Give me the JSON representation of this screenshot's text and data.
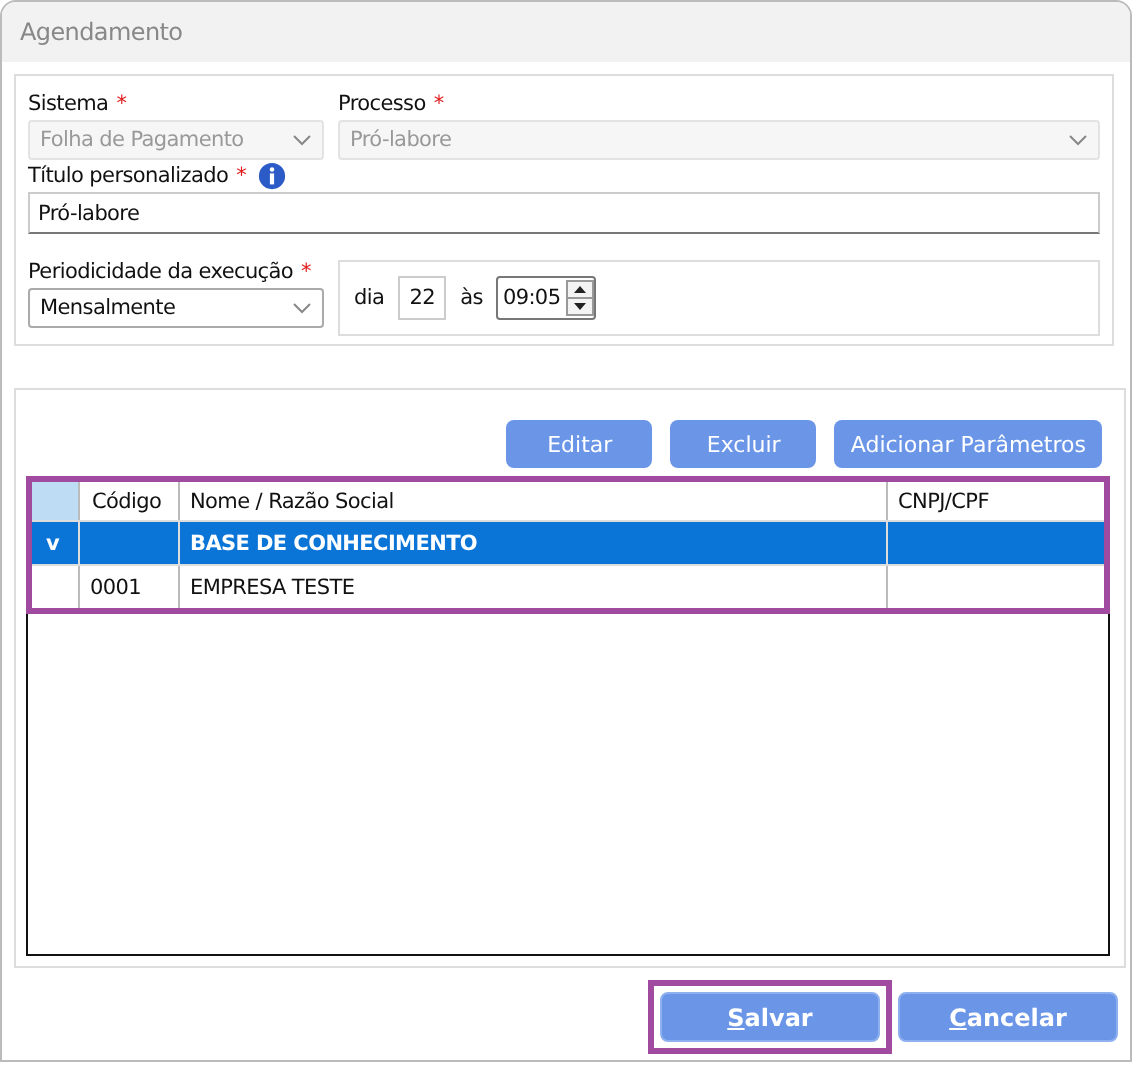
{
  "window": {
    "title": "Agendamento"
  },
  "form": {
    "sistema": {
      "label": "Sistema",
      "required_mark": "*",
      "value": "Folha de Pagamento",
      "disabled": true
    },
    "processo": {
      "label": "Processo",
      "required_mark": "*",
      "value": "Pró-labore",
      "disabled": true
    },
    "titulo": {
      "label": "Título personalizado",
      "required_mark": "*",
      "value": "Pró-labore"
    },
    "periodicidade": {
      "label": "Periodicidade da execução",
      "required_mark": "*",
      "value": "Mensalmente",
      "disabled": false
    },
    "dia_label": "dia",
    "dia": "22",
    "as_label": "às",
    "hora": "09:05"
  },
  "toolbar": [
    "Editar",
    "Excluir",
    "Adicionar Parâmetros"
  ],
  "table": {
    "columns": [
      "Código",
      "Nome / Razão Social",
      "CNPJ/CPF"
    ],
    "rows": [
      {
        "marker": "v",
        "cells": [
          "",
          "BASE DE CONHECIMENTO",
          ""
        ],
        "selected": true
      },
      {
        "marker": "",
        "cells": [
          "0001",
          "EMPRESA TESTE",
          ""
        ],
        "selected": false
      }
    ]
  },
  "buttons": [
    "Salvar",
    "Cancelar"
  ]
}
